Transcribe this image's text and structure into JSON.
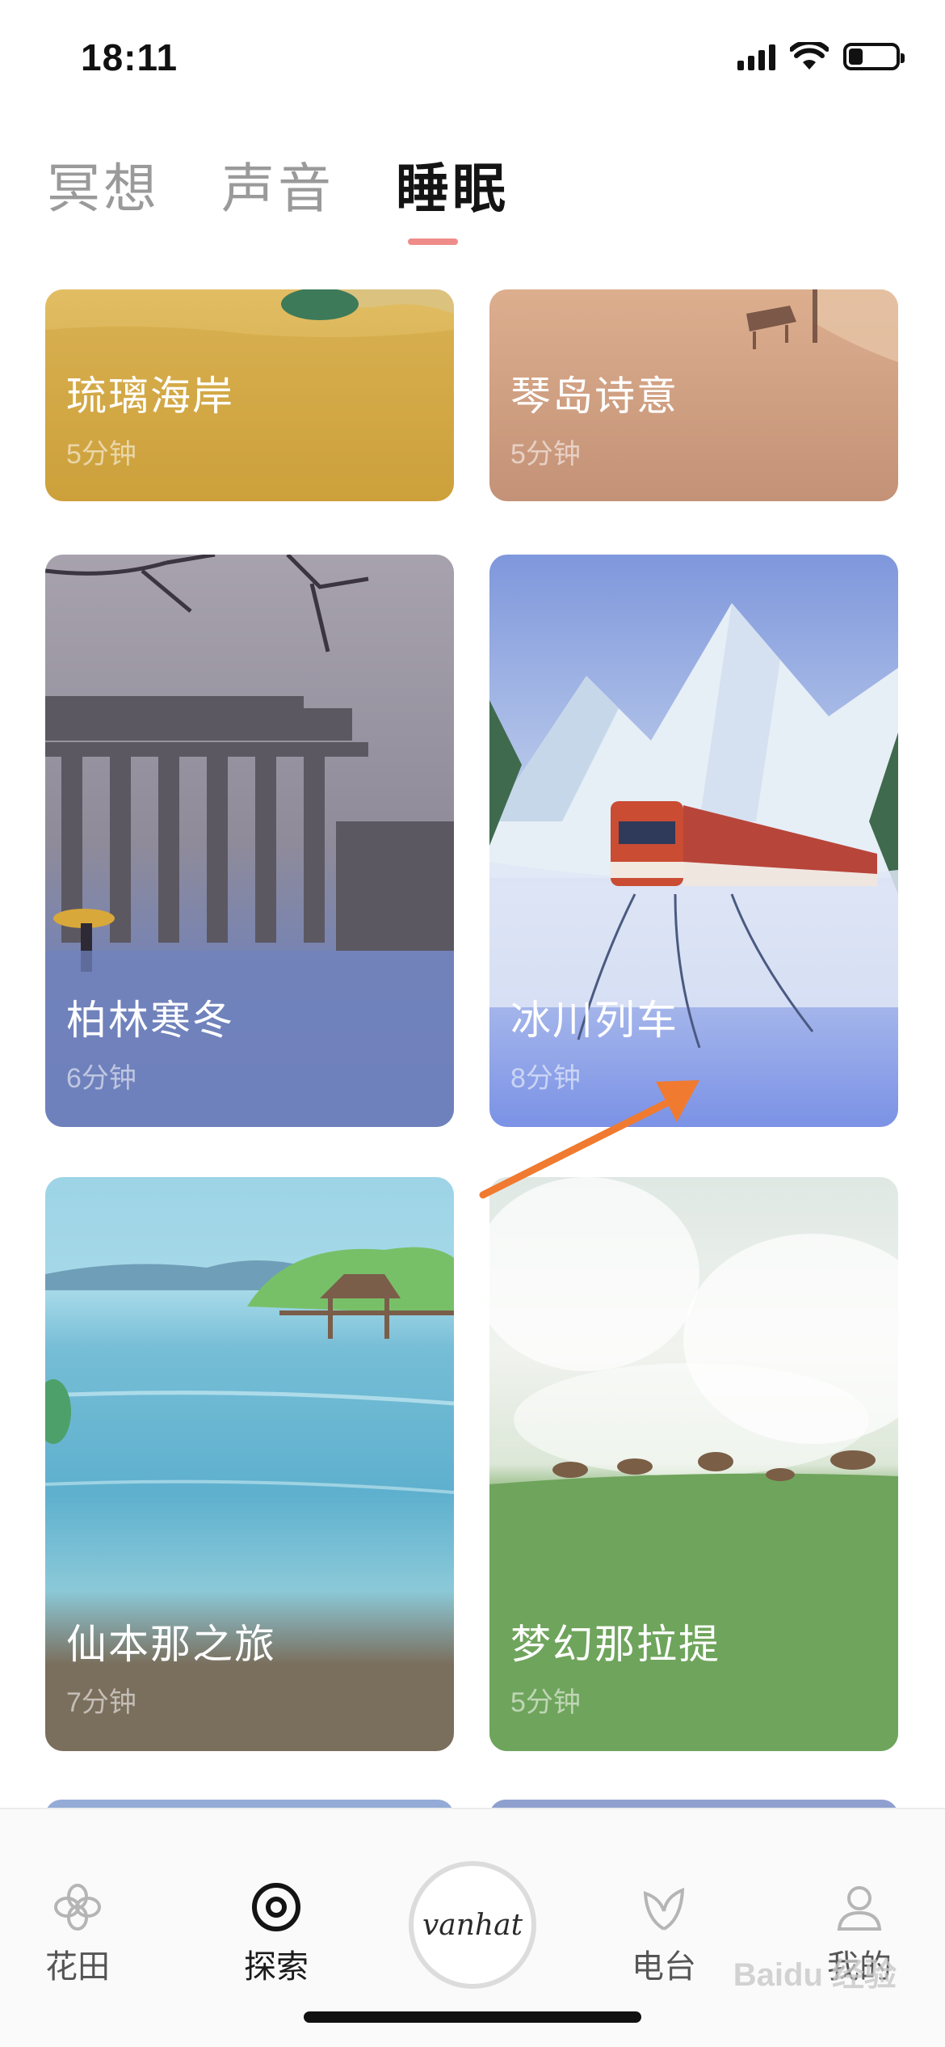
{
  "status_bar": {
    "time": "18:11",
    "battery_level": 0.3
  },
  "tabs": [
    {
      "label": "冥想",
      "active": false
    },
    {
      "label": "声音",
      "active": false
    },
    {
      "label": "睡眠",
      "active": true
    }
  ],
  "cards": [
    {
      "title": "琉璃海岸",
      "duration": "5分钟",
      "color": "#d4a84b"
    },
    {
      "title": "琴岛诗意",
      "duration": "5分钟",
      "color": "#c99a7c"
    },
    {
      "title": "柏林寒冬",
      "duration": "6分钟",
      "color": "#6a7fb8"
    },
    {
      "title": "冰川列车",
      "duration": "8分钟",
      "color": "#7b92e6"
    },
    {
      "title": "仙本那之旅",
      "duration": "7分钟",
      "color": "#7a6e5c"
    },
    {
      "title": "梦幻那拉提",
      "duration": "5分钟",
      "color": "#5a8f55"
    }
  ],
  "bottom_nav": {
    "items": [
      {
        "label": "花田",
        "icon": "flower-icon",
        "active": false
      },
      {
        "label": "探索",
        "icon": "explore-icon",
        "active": true
      },
      {
        "label": "电台",
        "icon": "leaf-icon",
        "active": false
      },
      {
        "label": "我的",
        "icon": "profile-icon",
        "active": false
      }
    ],
    "center_label": "vanhat"
  },
  "watermark": "Baidu 经验",
  "colors": {
    "tab_indicator": "#ef8c8a",
    "annotation_arrow": "#f07a30"
  }
}
